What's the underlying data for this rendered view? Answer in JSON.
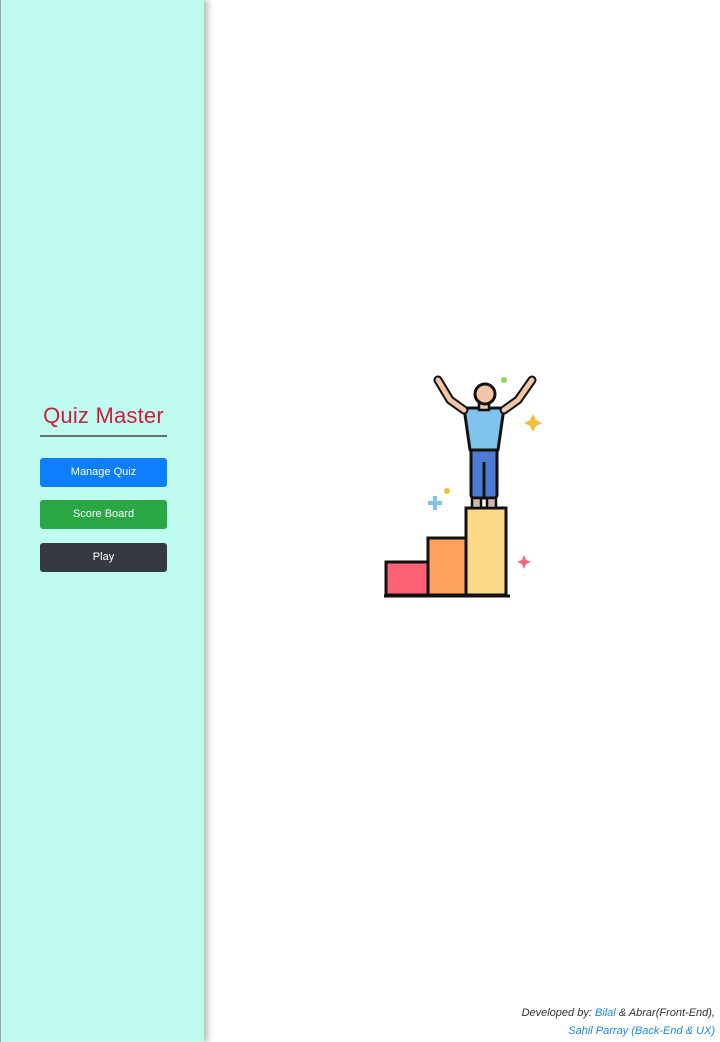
{
  "sidebar": {
    "title": "Quiz Master",
    "buttons": {
      "manage_quiz": "Manage Quiz",
      "score_board": "Score Board",
      "play": "Play"
    }
  },
  "illustration": {
    "icon": "winner-podium-icon"
  },
  "footer": {
    "prefix": "Developed by:",
    "dev1": "Bilal",
    "dev1_suffix": "& Abrar(Front-End),",
    "dev2": "Sahil Parray (Back-End & UX)"
  },
  "colors": {
    "sidebar_bg": "#c0fbf0",
    "title": "#c8203f",
    "manage": "#0d7efe",
    "score": "#2aa744",
    "play": "#343a40",
    "link": "#1a8bd9"
  }
}
